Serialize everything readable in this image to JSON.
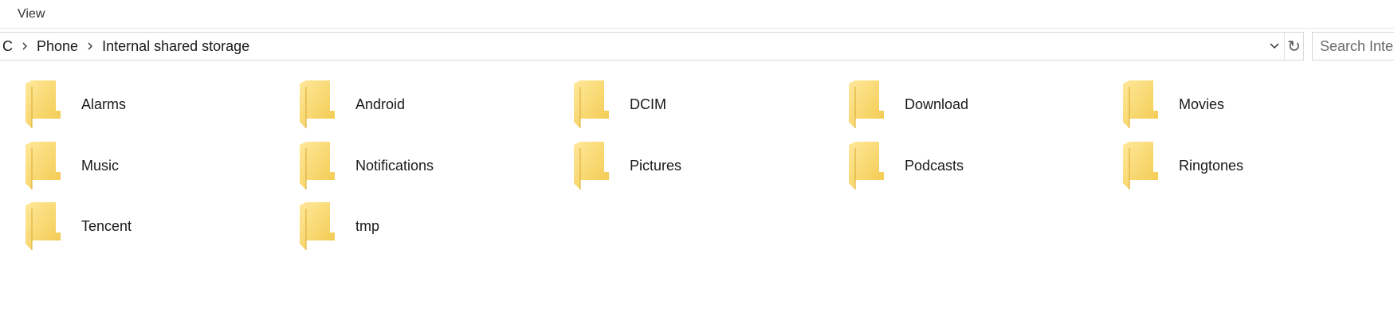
{
  "ribbon": {
    "tabs": [
      {
        "label": "View"
      }
    ]
  },
  "address_bar": {
    "breadcrumbs": [
      {
        "label": "C"
      },
      {
        "label": "Phone"
      },
      {
        "label": "Internal shared storage"
      }
    ],
    "separator_icon": "chevron-right-icon",
    "dropdown_icon": "chevron-down-icon",
    "refresh_icon": "refresh-icon",
    "refresh_glyph": "↻"
  },
  "search": {
    "placeholder": "Search Internal shared storage",
    "value": ""
  },
  "folders": [
    {
      "name": "Alarms"
    },
    {
      "name": "Android"
    },
    {
      "name": "DCIM"
    },
    {
      "name": "Download"
    },
    {
      "name": "Movies"
    },
    {
      "name": "Music"
    },
    {
      "name": "Notifications"
    },
    {
      "name": "Pictures"
    },
    {
      "name": "Podcasts"
    },
    {
      "name": "Ringtones"
    },
    {
      "name": "Tencent"
    },
    {
      "name": "tmp"
    }
  ],
  "colors": {
    "folder_light": "#FFE89A",
    "folder_dark": "#F2C94C",
    "folder_back": "#E8B93E"
  }
}
